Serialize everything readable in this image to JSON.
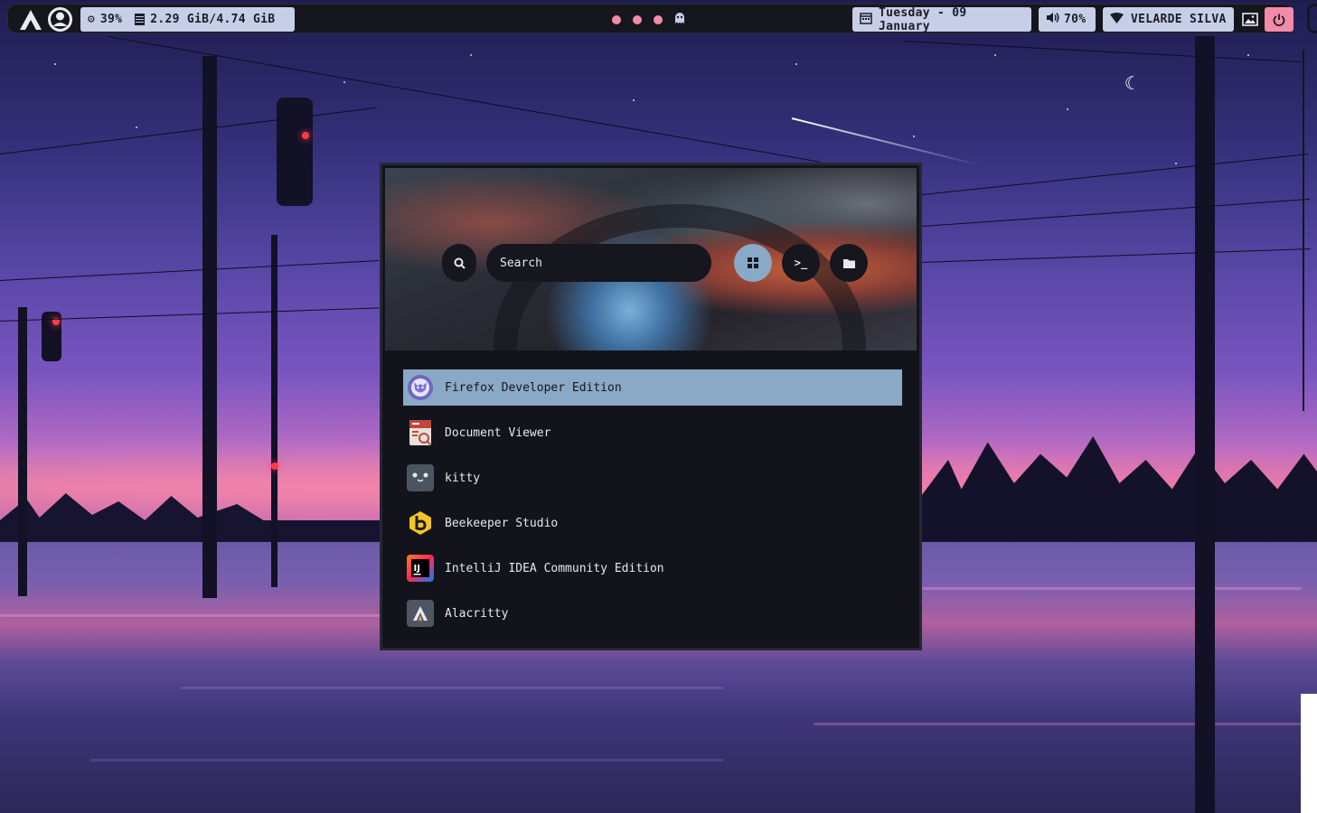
{
  "topbar": {
    "cpu": "39%",
    "memory": "2.29 GiB/4.74 GiB",
    "date": "Tuesday - 09 January",
    "volume": "70%",
    "network": "VELARDE SILVA"
  },
  "launcher": {
    "search_placeholder": "Search",
    "modes": [
      {
        "name": "apps",
        "icon": "grid-icon",
        "active": true
      },
      {
        "name": "run",
        "icon": "terminal-icon",
        "active": false
      },
      {
        "name": "files",
        "icon": "folder-icon",
        "active": false
      }
    ],
    "apps": [
      {
        "label": "Firefox Developer Edition",
        "icon": "firefox-developer-icon",
        "selected": true
      },
      {
        "label": "Document Viewer",
        "icon": "document-viewer-icon",
        "selected": false
      },
      {
        "label": "kitty",
        "icon": "kitty-icon",
        "selected": false
      },
      {
        "label": "Beekeeper Studio",
        "icon": "beekeeper-icon",
        "selected": false
      },
      {
        "label": "IntelliJ IDEA Community Edition",
        "icon": "intellij-icon",
        "selected": false
      },
      {
        "label": "Alacritty",
        "icon": "alacritty-icon",
        "selected": false
      }
    ]
  },
  "colors": {
    "bar_bg": "#15161e",
    "bar_module": "#c7cee8",
    "accent_pink": "#f38ba8",
    "selection": "#8aa9c6",
    "launcher_bg": "#13141b"
  }
}
